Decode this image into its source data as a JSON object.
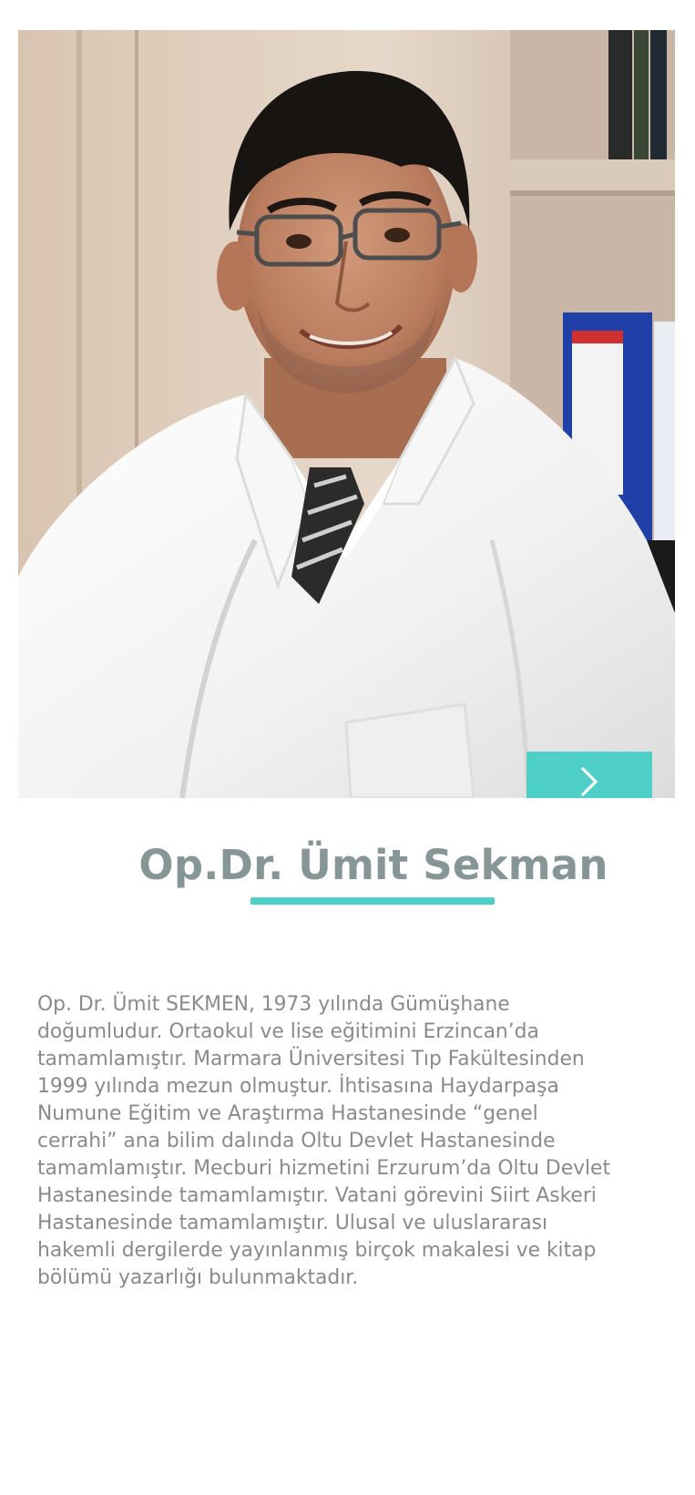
{
  "profile": {
    "name": "Op.Dr. Ümit Sekman",
    "photo_icon": "doctor-portrait",
    "next_icon": "chevron-right-icon",
    "bio_lines": [
      "Op. Dr. Ümit SEKMEN, 1973 yılında Gümüşhane",
      "doğumludur. Ortaokul ve lise eğitimini Erzincan’da",
      "tamamlamıştır. Marmara Üniversitesi Tıp Fakültesinden",
      "1999 yılında mezun olmuştur. İhtisasına Haydarpaşa",
      "Numune Eğitim ve Araştırma Hastanesinde “genel",
      "cerrahi” ana bilim dalında Oltu Devlet Hastanesinde",
      "tamamlamıştır. Mecburi hizmetini Erzurum’da Oltu Devlet",
      "Hastanesinde tamamlamıştır. Vatani görevini Siirt Askeri",
      "Hastanesinde tamamlamıştır. Ulusal ve uluslararası",
      "hakemli dergilerde yayınlanmış birçok makalesi ve kitap",
      "bölümü yazarlığı bulunmaktadır."
    ]
  },
  "colors": {
    "accent": "#4ecfc8",
    "name_text": "#869595",
    "body_text": "#8a8a8a"
  }
}
